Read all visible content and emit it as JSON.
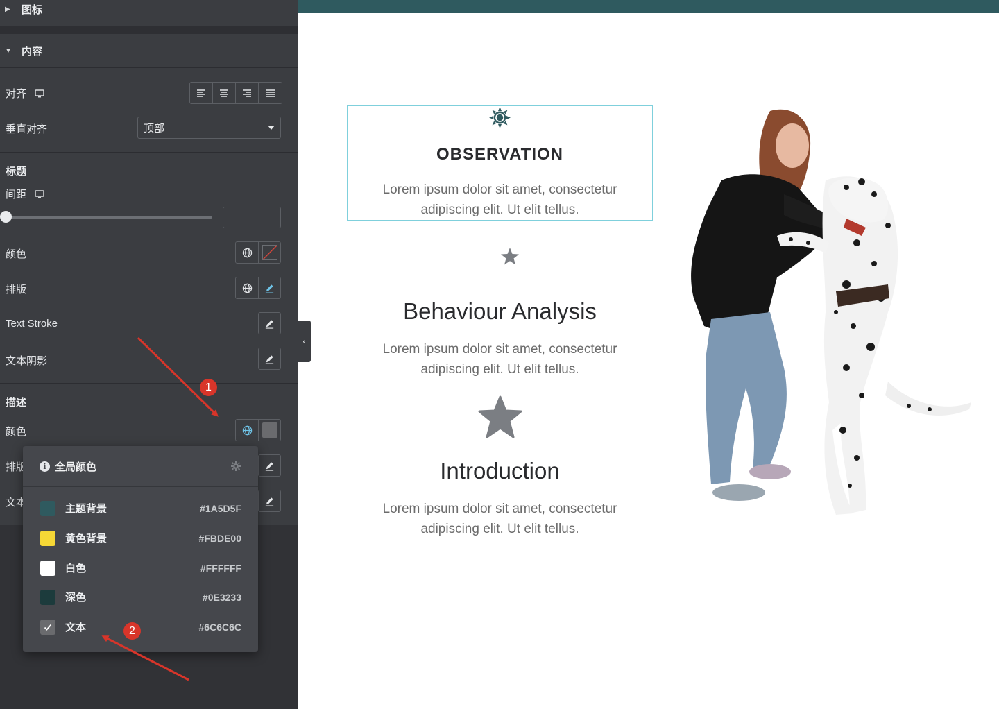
{
  "panel": {
    "icon_section": {
      "label": "图标",
      "state": "collapsed"
    },
    "content_section": {
      "label": "内容",
      "state": "expanded"
    },
    "align": {
      "label": "对齐",
      "options": [
        "align-left-icon",
        "align-center-icon",
        "align-right-icon",
        "align-justify-icon"
      ]
    },
    "vertical_align": {
      "label": "垂直对齐",
      "value": "顶部"
    },
    "title_group": {
      "heading": "标题",
      "spacing_label": "间距",
      "color_label": "颜色",
      "typography_label": "排版",
      "text_stroke_label": "Text Stroke",
      "text_shadow_label": "文本阴影"
    },
    "description_group": {
      "heading": "描述",
      "color_label": "颜色",
      "typography_label": "排版",
      "text_label": "文本"
    }
  },
  "popup": {
    "title": "全局颜色",
    "colors": [
      {
        "name": "主题背景",
        "hex": "#1A5D5F",
        "swatch": "#2f5a5f",
        "checked": false
      },
      {
        "name": "黄色背景",
        "hex": "#FBDE00",
        "swatch": "#f6d836",
        "checked": false
      },
      {
        "name": "白色",
        "hex": "#FFFFFF",
        "swatch": "#ffffff",
        "checked": false
      },
      {
        "name": "深色",
        "hex": "#0E3233",
        "swatch": "#1c3b3c",
        "checked": false
      },
      {
        "name": "文本",
        "hex": "#6C6C6C",
        "swatch": "#6a6b6e",
        "checked": true
      }
    ]
  },
  "annotations": {
    "badge_1": "1",
    "badge_2": "2"
  },
  "preview": {
    "accent_color": "#2f5a5f",
    "items": [
      {
        "icon": "sun-gear-icon",
        "title": "OBSERVATION",
        "body_line1": "Lorem ipsum dolor sit amet, consectetur",
        "body_line2": "adipiscing elit. Ut elit tellus."
      },
      {
        "icon": "moon-star-icon",
        "title": "Behaviour Analysis",
        "body_line1": "Lorem ipsum dolor sit amet, consectetur",
        "body_line2": "adipiscing elit. Ut elit tellus."
      },
      {
        "icon": "star-icon",
        "title": "Introduction",
        "body_line1": "Lorem ipsum dolor sit amet, consectetur",
        "body_line2": "adipiscing elit. Ut elit tellus."
      }
    ],
    "image_alt": "woman-playing-with-dalmatian"
  }
}
